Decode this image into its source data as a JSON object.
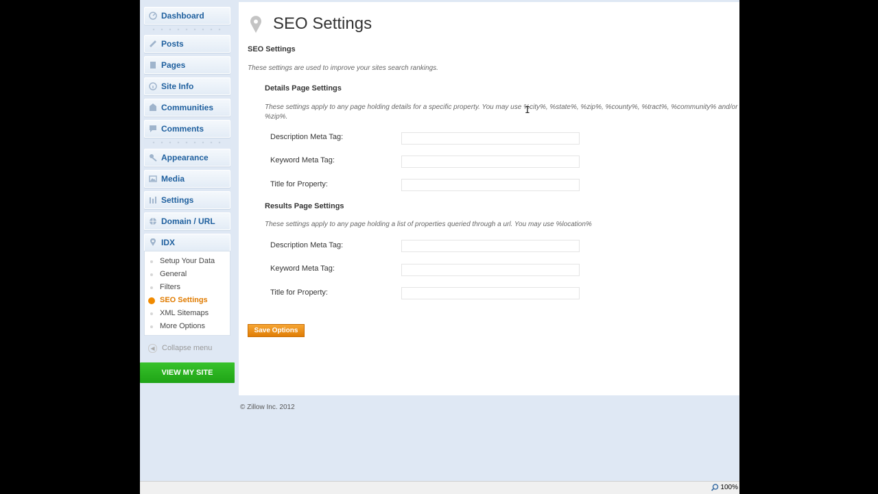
{
  "sidebar": {
    "items": [
      {
        "label": "Dashboard",
        "icon": "dashboard-icon"
      },
      {
        "label": "Posts",
        "icon": "posts-icon"
      },
      {
        "label": "Pages",
        "icon": "pages-icon"
      },
      {
        "label": "Site Info",
        "icon": "site-info-icon"
      },
      {
        "label": "Communities",
        "icon": "communities-icon"
      },
      {
        "label": "Comments",
        "icon": "comments-icon"
      },
      {
        "label": "Appearance",
        "icon": "appearance-icon"
      },
      {
        "label": "Media",
        "icon": "media-icon"
      },
      {
        "label": "Settings",
        "icon": "settings-icon"
      },
      {
        "label": "Domain / URL",
        "icon": "domain-icon"
      },
      {
        "label": "IDX",
        "icon": "location-pin-icon"
      }
    ],
    "submenu": [
      {
        "label": "Setup Your Data",
        "active": false
      },
      {
        "label": "General",
        "active": false
      },
      {
        "label": "Filters",
        "active": false
      },
      {
        "label": "SEO Settings",
        "active": true
      },
      {
        "label": "XML Sitemaps",
        "active": false
      },
      {
        "label": "More Options",
        "active": false
      }
    ],
    "collapse_label": "Collapse menu",
    "view_site_label": "VIEW MY SITE"
  },
  "main": {
    "title": "SEO Settings",
    "section_heading": "SEO Settings",
    "section_desc": "These settings are used to improve your sites search rankings.",
    "details": {
      "heading": "Details Page Settings",
      "desc": "These settings apply to any page holding details for a specific property. You may use %city%, %state%, %zip%, %county%, %tract%, %community% and/or %zip%.",
      "fields": [
        {
          "label": "Description Meta Tag:",
          "value": ""
        },
        {
          "label": "Keyword Meta Tag:",
          "value": ""
        },
        {
          "label": "Title for Property:",
          "value": ""
        }
      ]
    },
    "results": {
      "heading": "Results Page Settings",
      "desc": "These settings apply to any page holding a list of properties queried through a url. You may use %location%",
      "fields": [
        {
          "label": "Description Meta Tag:",
          "value": ""
        },
        {
          "label": "Keyword Meta Tag:",
          "value": ""
        },
        {
          "label": "Title for Property:",
          "value": ""
        }
      ]
    },
    "save_label": "Save Options"
  },
  "footer": "© Zillow Inc. 2012",
  "status": {
    "zoom": "100%"
  },
  "colors": {
    "accent": "#f08a00",
    "link": "#1e5f9e",
    "view_site": "#26ad1c",
    "background": "#dfe8f4"
  }
}
